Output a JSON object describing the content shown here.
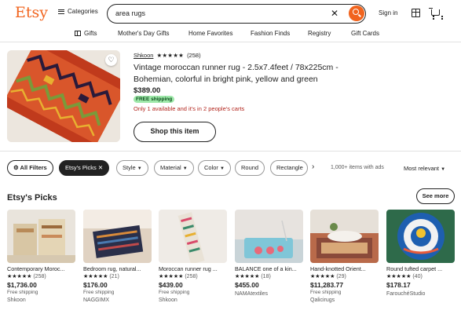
{
  "header": {
    "logo": "Etsy",
    "categories_label": "Categories",
    "search_value": "area rugs",
    "signin_label": "Sign in"
  },
  "subnav": {
    "items": [
      "Gifts",
      "Mother's Day Gifts",
      "Home Favorites",
      "Fashion Finds",
      "Registry",
      "Gift Cards"
    ]
  },
  "ad": {
    "shop_name": "Shkoon",
    "stars": "★★★★★",
    "review_count": "(258)",
    "title": "Vintage moroccan runner rug - 2.5x7.4feet / 78x225cm - Bohemian, colorful in bright pink, yellow and green",
    "price": "$389.00",
    "shipping_badge": "FREE shipping",
    "stock_note": "Only 1 available and it's in 2 people's carts",
    "shop_button": "Shop this item"
  },
  "filters": {
    "all_filters": "All Filters",
    "etsys_picks": "Etsy's Picks",
    "style": "Style",
    "material": "Material",
    "color": "Color",
    "round": "Round",
    "rectangle": "Rectangle",
    "results": "1,000+ items with ads",
    "sort": "Most relevant"
  },
  "picks": {
    "title": "Etsy's Picks",
    "see_more": "See more",
    "items": [
      {
        "title": "Contemporary Moroc...",
        "stars": "★★★★★",
        "count": "(258)",
        "price": "$1,736.00",
        "shipping": "Free shipping",
        "shop": "Shkoon"
      },
      {
        "title": "Bedroom rug, natural...",
        "stars": "★★★★★",
        "count": "(21)",
        "price": "$176.00",
        "shipping": "Free shipping",
        "shop": "NAGGIMX"
      },
      {
        "title": "Moroccan runner rug ...",
        "stars": "★★★★★",
        "count": "(258)",
        "price": "$439.00",
        "shipping": "Free shipping",
        "shop": "Shkoon"
      },
      {
        "title": "BALANCE one of a kin...",
        "stars": "★★★★★",
        "count": "(18)",
        "price": "$455.00",
        "shipping": "",
        "shop": "NAMAtextiles"
      },
      {
        "title": "Hand-knotted Orient...",
        "stars": "★★★★★",
        "count": "(29)",
        "price": "$11,283.77",
        "shipping": "Free shipping",
        "shop": "Qalicirugs"
      },
      {
        "title": "Round tufted carpet ...",
        "stars": "★★★★★",
        "count": "(40)",
        "price": "$178.17",
        "shipping": "",
        "shop": "FarouchéStudio"
      }
    ]
  },
  "colors": {
    "brand": "#F1641E",
    "badge_green": "#9ee8a9",
    "stock_red": "#b3261e"
  }
}
